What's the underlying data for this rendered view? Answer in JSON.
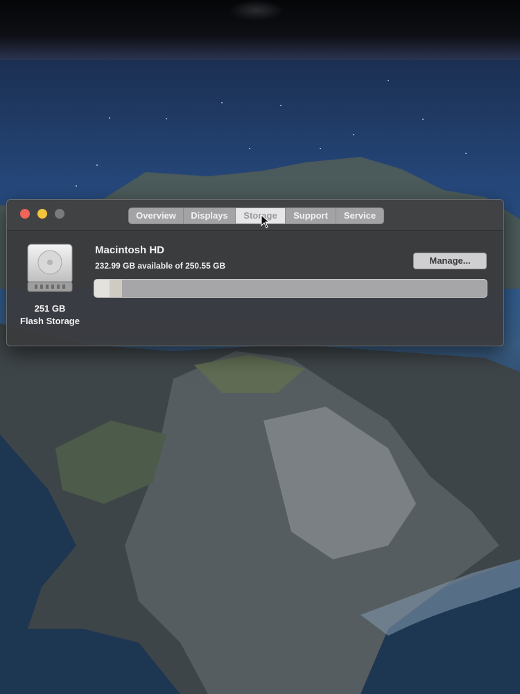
{
  "window": {
    "tabs": [
      {
        "label": "Overview"
      },
      {
        "label": "Displays"
      },
      {
        "label": "Storage",
        "active": true
      },
      {
        "label": "Support"
      },
      {
        "label": "Service"
      }
    ],
    "disk": {
      "capacity": "251 GB",
      "type": "Flash Storage",
      "icon": "hard-drive-icon"
    },
    "volume": {
      "name": "Macintosh HD",
      "availability": "232.99 GB available of 250.55 GB",
      "used_fraction": 0.07
    },
    "manage_label": "Manage..."
  },
  "colors": {
    "window_bg": "#3a3a3c",
    "close": "#f0645a",
    "minimize": "#f2c43c",
    "zoom": "#7a7a7c",
    "bar_free": "#a6a6a8",
    "bar_used": "#e4e2dc"
  }
}
